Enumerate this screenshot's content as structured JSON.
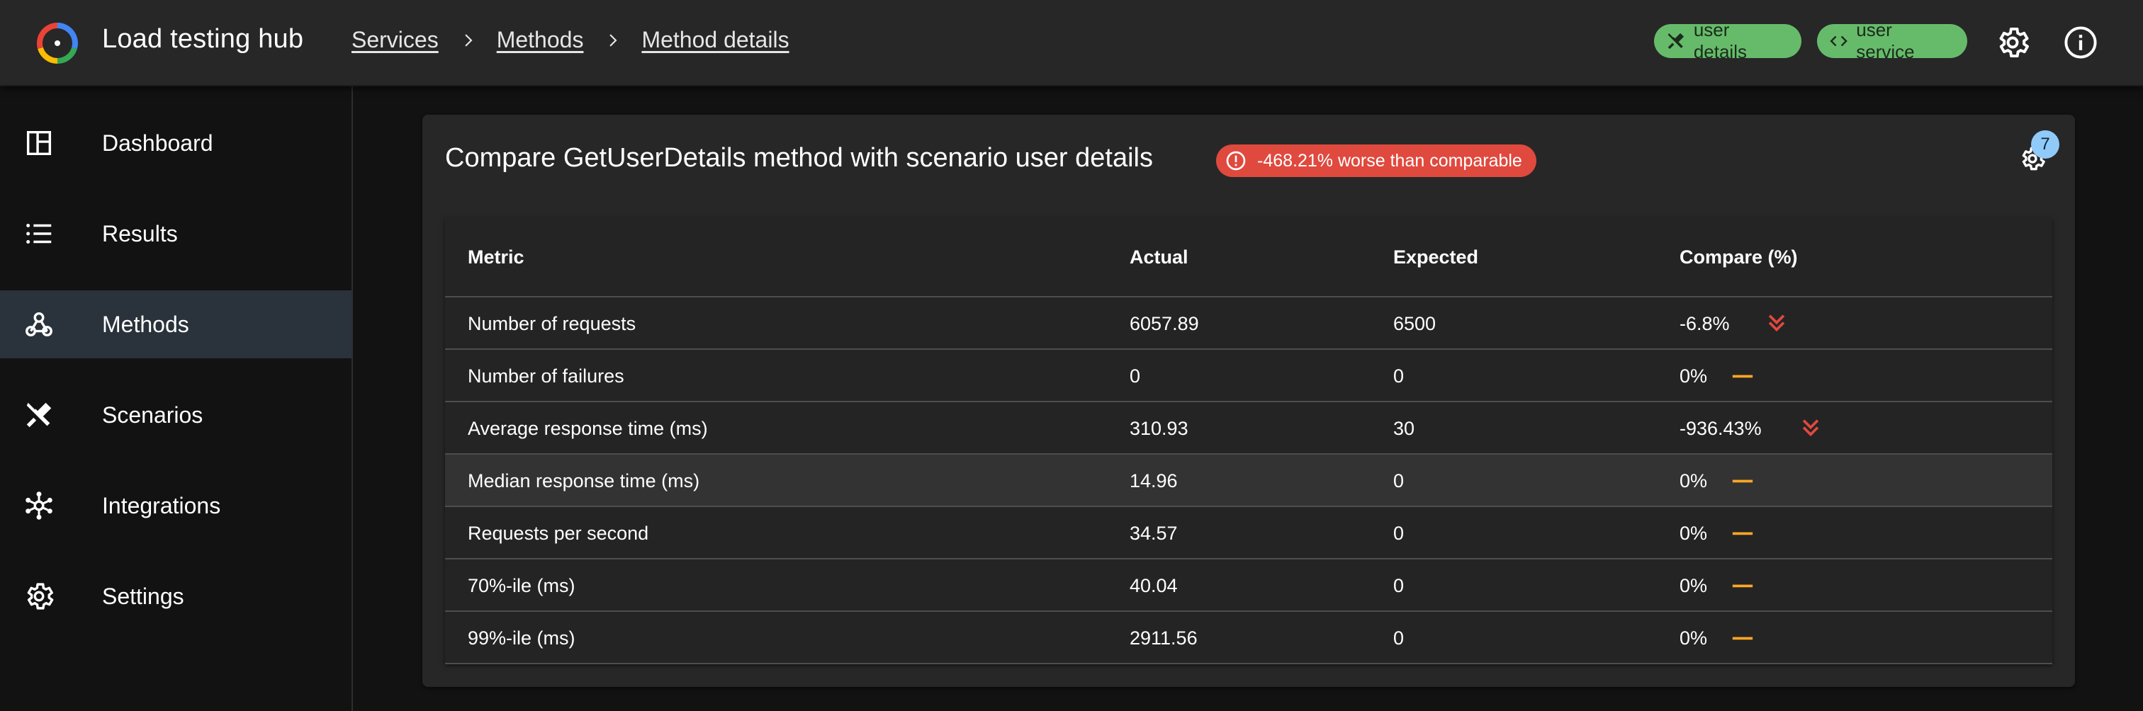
{
  "app": {
    "title": "Load testing hub"
  },
  "breadcrumb": [
    "Services",
    "Methods",
    "Method details"
  ],
  "header_chips": [
    {
      "label": "user details",
      "icon": "tools-icon"
    },
    {
      "label": "user service",
      "icon": "code-icon"
    }
  ],
  "sidebar": {
    "items": [
      {
        "label": "Dashboard",
        "icon": "dashboard-icon",
        "active": false
      },
      {
        "label": "Results",
        "icon": "list-icon",
        "active": false
      },
      {
        "label": "Methods",
        "icon": "webhook-icon",
        "active": true
      },
      {
        "label": "Scenarios",
        "icon": "tools-icon",
        "active": false
      },
      {
        "label": "Integrations",
        "icon": "hub-icon",
        "active": false
      },
      {
        "label": "Settings",
        "icon": "gear-icon",
        "active": false
      }
    ]
  },
  "panel": {
    "title": "Compare GetUserDetails method with scenario user details",
    "status_chip": "-468.21% worse than comparable",
    "settings_badge": "7"
  },
  "table": {
    "headers": [
      "Metric",
      "Actual",
      "Expected",
      "Compare (%)"
    ],
    "rows": [
      {
        "metric": "Number of requests",
        "actual": "6057.89",
        "expected": "6500",
        "compare": "-6.8%",
        "trend": "down-double"
      },
      {
        "metric": "Number of failures",
        "actual": "0",
        "expected": "0",
        "compare": "0%",
        "trend": "equal"
      },
      {
        "metric": "Average response time (ms)",
        "actual": "310.93",
        "expected": "30",
        "compare": "-936.43%",
        "trend": "down-double"
      },
      {
        "metric": "Median response time (ms)",
        "actual": "14.96",
        "expected": "0",
        "compare": "0%",
        "trend": "equal"
      },
      {
        "metric": "Requests per second",
        "actual": "34.57",
        "expected": "0",
        "compare": "0%",
        "trend": "equal"
      },
      {
        "metric": "70%-ile (ms)",
        "actual": "40.04",
        "expected": "0",
        "compare": "0%",
        "trend": "equal"
      },
      {
        "metric": "99%-ile (ms)",
        "actual": "2911.56",
        "expected": "0",
        "compare": "0%",
        "trend": "equal"
      }
    ]
  },
  "colors": {
    "chip_green": "#66bb6a",
    "danger": "#e0493e",
    "warning_dash": "#ffa726",
    "badge_blue": "#90caf9",
    "active_nav": "#2a323b"
  }
}
